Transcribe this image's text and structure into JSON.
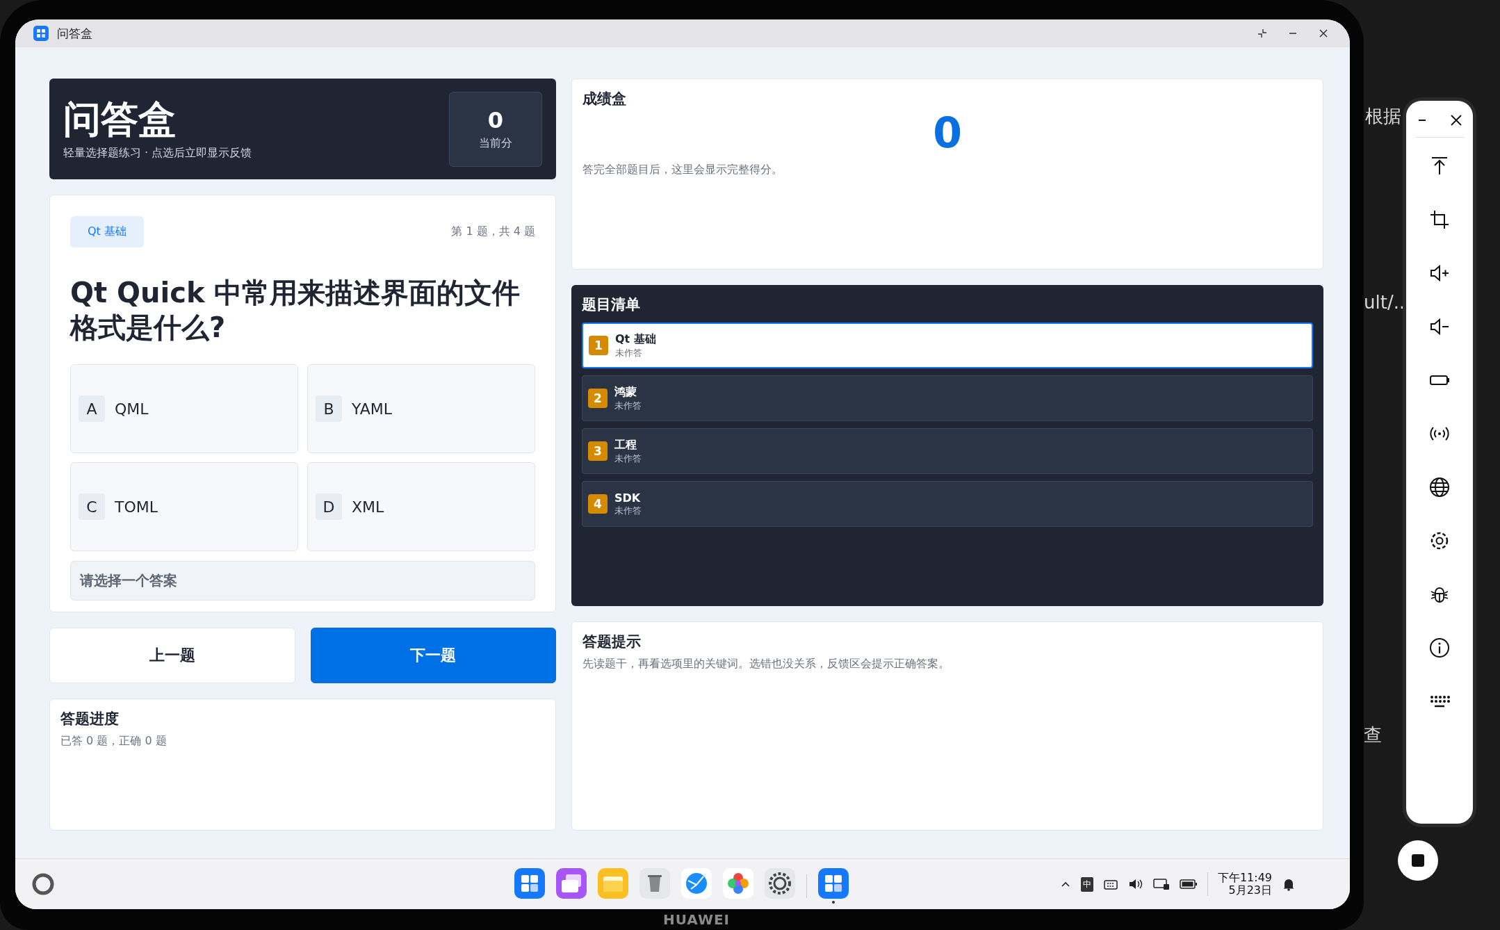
{
  "window": {
    "title": "问答盒"
  },
  "header": {
    "title": "问答盒",
    "subtitle": "轻量选择题练习 · 点选后立即显示反馈",
    "score": "0",
    "score_label": "当前分"
  },
  "question": {
    "tag": "Qt 基础",
    "position": "第 1 题，共 4 题",
    "text": "Qt Quick 中常用来描述界面的文件格式是什么?",
    "feedback": "请选择一个答案",
    "options": [
      {
        "letter": "A",
        "text": "QML",
        "selected": false
      },
      {
        "letter": "B",
        "text": "YAML",
        "selected": false
      },
      {
        "letter": "C",
        "text": "TOML",
        "selected": false
      },
      {
        "letter": "D",
        "text": "XML",
        "selected": false
      }
    ]
  },
  "nav_buttons": [
    {
      "label": "上一题",
      "kind": "secondary"
    },
    {
      "label": "下一题",
      "kind": "primary"
    }
  ],
  "progress": {
    "title": "答题进度",
    "text": "已答 0 题，正确 0 题"
  },
  "score_card": {
    "title": "成绩盒",
    "score": "0",
    "note": "答完全部题目后，这里会显示完整得分。"
  },
  "question_list": {
    "title": "题目清单",
    "items": [
      {
        "number": "1",
        "title": "Qt 基础",
        "status": "未作答",
        "selected": true
      },
      {
        "number": "2",
        "title": "鸿蒙",
        "status": "未作答",
        "selected": false
      },
      {
        "number": "3",
        "title": "工程",
        "status": "未作答",
        "selected": false
      },
      {
        "number": "4",
        "title": "SDK",
        "status": "未作答",
        "selected": false
      }
    ]
  },
  "hint": {
    "title": "答题提示",
    "text": "先读题干，再看选项里的关键词。选错也没关系，反馈区会提示正确答案。"
  },
  "taskbar": {
    "apps": [
      {
        "kind": "grid",
        "running": false
      },
      {
        "kind": "windows",
        "running": false
      },
      {
        "kind": "folder",
        "running": false
      },
      {
        "kind": "trash",
        "running": false
      },
      {
        "kind": "globe",
        "running": false
      },
      {
        "kind": "flower",
        "running": false
      },
      {
        "kind": "gear",
        "running": false
      }
    ],
    "open_apps": [
      {
        "kind": "grid",
        "running": true
      }
    ],
    "ime": "中",
    "time": "下午11:49",
    "date": "5月23日"
  },
  "device_label": "HUAWEI",
  "background_fragments": [
    "根据",
    "ult/..",
    "查"
  ]
}
